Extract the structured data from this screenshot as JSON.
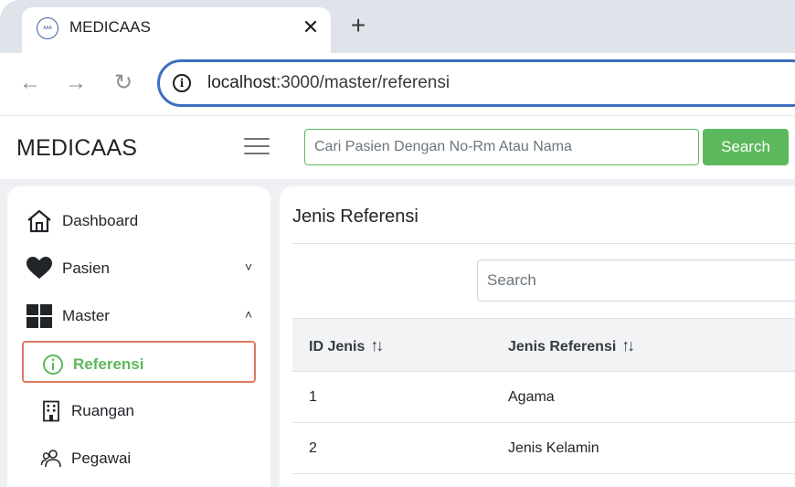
{
  "browser": {
    "tab": {
      "favicon_text": "AAA MEDICAAS",
      "title": "MEDICAAS",
      "close_icon": "close-icon"
    },
    "new_tab_icon": "plus-icon",
    "nav": {
      "back_icon": "arrow-left-icon",
      "forward_icon": "arrow-right-icon",
      "reload_icon": "reload-icon"
    },
    "url": {
      "host": "localhost",
      "path": ":3000/master/referensi"
    }
  },
  "header": {
    "brand": "MEDICAAS",
    "search_placeholder": "Cari Pasien Dengan No-Rm Atau Nama",
    "search_button": "Search",
    "accent_color": "#5cb85c"
  },
  "sidebar": {
    "items": [
      {
        "label": "Dashboard",
        "icon": "home-icon"
      },
      {
        "label": "Pasien",
        "icon": "heart-icon",
        "chevron": "˅"
      },
      {
        "label": "Master",
        "icon": "grid-icon",
        "chevron": "˄"
      }
    ],
    "sub_items": [
      {
        "label": "Referensi",
        "icon": "info-circle-icon",
        "active": true
      },
      {
        "label": "Ruangan",
        "icon": "building-icon"
      },
      {
        "label": "Pegawai",
        "icon": "people-icon"
      }
    ]
  },
  "content": {
    "title": "Jenis Referensi",
    "search_placeholder": "Search",
    "table": {
      "columns": [
        "ID Jenis",
        "Jenis Referensi"
      ],
      "sort_icon": "↑↓",
      "rows": [
        [
          "1",
          "Agama"
        ],
        [
          "2",
          "Jenis Kelamin"
        ]
      ]
    }
  }
}
